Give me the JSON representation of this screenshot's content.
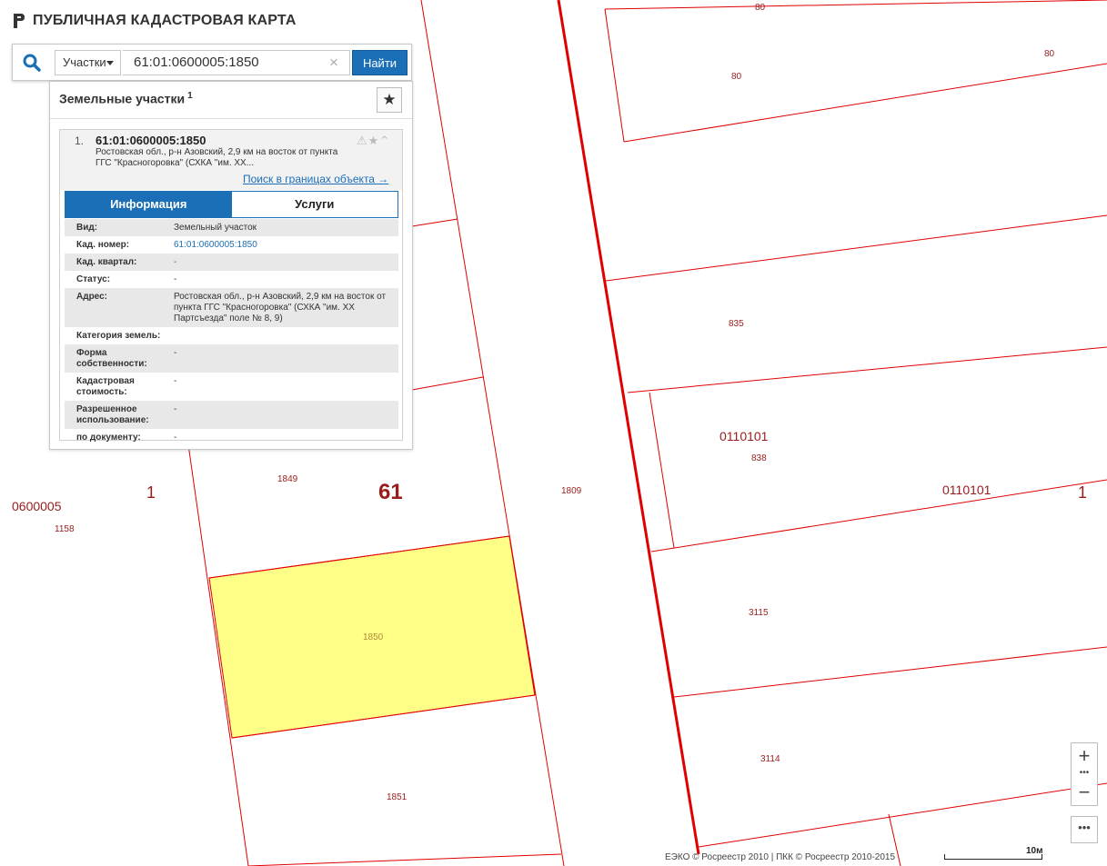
{
  "app": {
    "title": "ПУБЛИЧНАЯ КАДАСТРОВАЯ КАРТА"
  },
  "search": {
    "type_label": "Участки",
    "query": "61:01:0600005:1850",
    "clear": "×",
    "find_label": "Найти"
  },
  "panel": {
    "title": "Земельные участки",
    "count": "1",
    "fav_glyph": "★"
  },
  "result": {
    "index": "1.",
    "number": "61:01:0600005:1850",
    "address_short": "Ростовская обл., р-н Азовский, 2,9 км на восток от пункта ГГС \"Красногоровка\" (СХКА \"им. ХХ...",
    "icons": "⚠★⌃",
    "search_in_bounds": "Поиск в границах объекта →"
  },
  "tabs": [
    {
      "label": "Информация",
      "active": true
    },
    {
      "label": "Услуги",
      "active": false
    }
  ],
  "info": [
    {
      "key": "Вид:",
      "value": "Земельный участок",
      "link": false
    },
    {
      "key": "Кад. номер:",
      "value": "61:01:0600005:1850",
      "link": true
    },
    {
      "key": "Кад. квартал:",
      "value": "-",
      "link": true
    },
    {
      "key": "Статус:",
      "value": "-",
      "link": false
    },
    {
      "key": "Адрес:",
      "value": "Ростовская обл., р-н Азовский, 2,9 км на восток от пункта ГГС \"Красногоровка\" (СХКА \"им. ХХ Партсъезда\" поле № 8, 9)",
      "link": false
    },
    {
      "key": "Категория земель:",
      "value": "",
      "link": false
    },
    {
      "key": "Форма собственности:",
      "value": "-",
      "link": false
    },
    {
      "key": "Кадастровая стоимость:",
      "value": "-",
      "link": false
    },
    {
      "key": "Разрешенное использование:",
      "value": "-",
      "link": false
    },
    {
      "key": "по документу:",
      "value": "-",
      "link": false
    }
  ],
  "map": {
    "line_color": "#e00000",
    "highlight_fill": "#ffff88",
    "label_color": "#9b1b1b",
    "labels": [
      "80",
      "80",
      "80",
      "835",
      "0110101",
      "838",
      "1849",
      "61",
      "1809",
      "0110101",
      "1",
      "0600005",
      "1158",
      "1",
      "1850",
      "3115",
      "3114",
      "1851"
    ]
  },
  "controls": {
    "zoom_in": "+",
    "zoom_out": "−",
    "zoom_dots": "•••",
    "more": "•••"
  },
  "footer": {
    "copyright": "ЕЭКО © Росреестр 2010 | ПКК © Росреестр 2010-2015",
    "scale": "10м"
  }
}
